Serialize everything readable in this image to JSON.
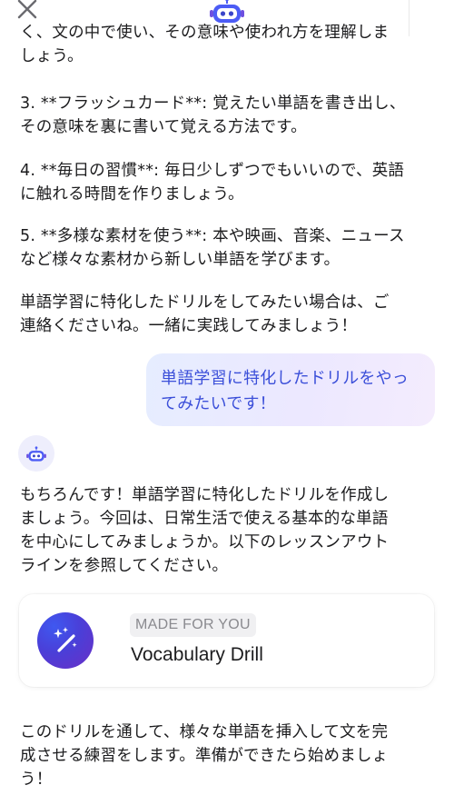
{
  "header": {
    "close_icon": "close-icon",
    "avatar_icon": "robot-icon"
  },
  "messages": {
    "partial_top": "く、文の中で使い、その意味や使われ方を理解しま\nしょう。",
    "tip3": "3. **フラッシュカード**: 覚えたい単語を書き出し、\nその意味を裏に書いて覚える方法です。",
    "tip4": "4. **毎日の習慣**: 毎日少しずつでもいいので、英語\nに触れる時間を作りましょう。",
    "tip5": "5. **多様な素材を使う**: 本や映画、音楽、ニュース\nなど様々な素材から新しい単語を学びます。",
    "offer": "単語学習に特化したドリルをしてみたい場合は、ご\n連絡くださいね。一緒に実践してみましょう！",
    "user_message": "単語学習に特化したドリルをやっ\nてみたいです！",
    "bot_reply": "もちろんです！単語学習に特化したドリルを作成し\nましょう。今回は、日常生活で使える基本的な単語\nを中心にしてみましょうか。以下のレッスンアウト\nラインを参照してください。",
    "closing": "このドリルを通して、様々な単語を挿入して文を完\n成させる練習をします。準備ができたら始めましょ\nう！"
  },
  "card": {
    "badge": "MADE FOR YOU",
    "title": "Vocabulary Drill",
    "icon": "magic-wand-icon"
  },
  "colors": {
    "accent": "#3b4fd9",
    "bubble_start": "#e6edff",
    "bubble_end": "#f4ecfd",
    "icon_gradient_start": "#3f58f0",
    "icon_gradient_end": "#6a2fc6",
    "badge_bg": "#f0f0f2",
    "badge_text": "#8a8a8f"
  }
}
